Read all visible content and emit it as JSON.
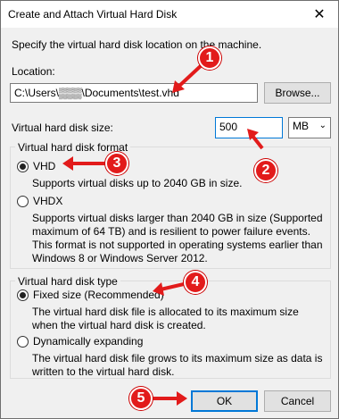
{
  "window": {
    "title": "Create and Attach Virtual Hard Disk",
    "close_glyph": "✕"
  },
  "intro": "Specify the virtual hard disk location on the machine.",
  "location": {
    "label": "Location:",
    "value": "C:\\Users\\▒▒▒\\Documents\\test.vhd",
    "browse": "Browse..."
  },
  "size": {
    "label": "Virtual hard disk size:",
    "value": "500",
    "unit": "MB"
  },
  "format": {
    "legend": "Virtual hard disk format",
    "vhd": {
      "label": "VHD",
      "desc": "Supports virtual disks up to 2040 GB in size.",
      "selected": true
    },
    "vhdx": {
      "label": "VHDX",
      "desc": "Supports virtual disks larger than 2040 GB in size (Supported maximum of 64 TB) and is resilient to power failure events. This format is not supported in operating systems earlier than Windows 8 or Windows Server 2012.",
      "selected": false
    }
  },
  "type": {
    "legend": "Virtual hard disk type",
    "fixed": {
      "label": "Fixed size (Recommended)",
      "desc": "The virtual hard disk file is allocated to its maximum size when the virtual hard disk is created.",
      "selected": true
    },
    "dynamic": {
      "label": "Dynamically expanding",
      "desc": "The virtual hard disk file grows to its maximum size as data is written to the virtual hard disk.",
      "selected": false
    }
  },
  "buttons": {
    "ok": "OK",
    "cancel": "Cancel"
  },
  "annotations": {
    "one": "1",
    "two": "2",
    "three": "3",
    "four": "4",
    "five": "5",
    "color": "#e21b1b"
  }
}
